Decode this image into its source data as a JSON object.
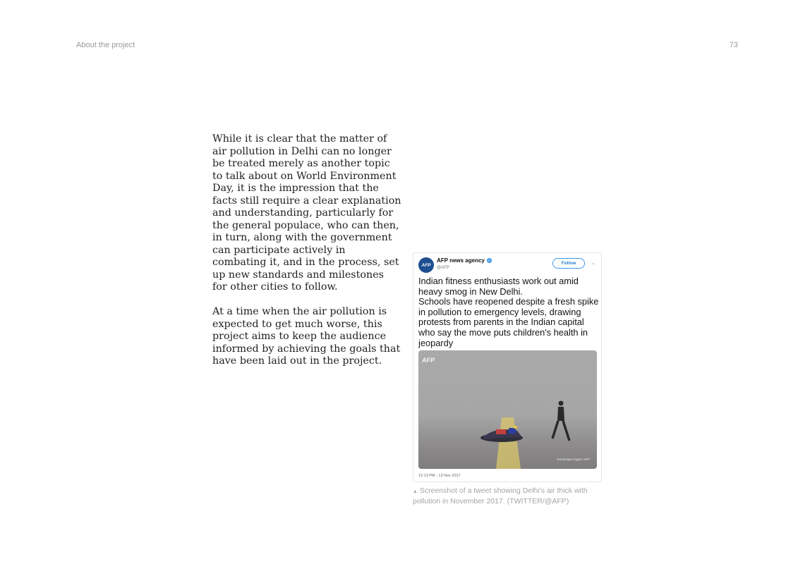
{
  "header": {
    "running_head": "About the project",
    "page_number": "73"
  },
  "body": {
    "paragraphs": [
      "While it is clear that the matter of air pollution in Delhi can no longer be treated merely as another topic to talk about on World Environment Day, it is the impression that the facts still require a clear explanation and understanding, particularly for the general populace, who can then, in turn, along with the government can participate actively in combating it, and in the process, set up new standards and milestones for other cities to follow.",
      "At a time when the air pollution is expected to get much worse, this project aims to keep the audience informed by achieving the goals that have been laid out in the project."
    ]
  },
  "figure": {
    "tweet": {
      "avatar_text": "AFP",
      "account_name": "AFP news agency",
      "verified_icon": "check-icon",
      "handle": "@AFP",
      "follow_label": "Follow",
      "chevron_icon": "chevron-down-icon",
      "text": "Indian fitness enthusiasts work out amid heavy smog in New Delhi.\nSchools have reopened despite a fresh spike in pollution to emergency levels, drawing protests from parents in the Indian capital who say the move puts children's health in jeopardy",
      "photo_logo": "AFP",
      "photo_credit": "Dominique Faget / AFP",
      "timestamp": "12:13 PM - 13 Nov 2017"
    },
    "caption_marker": "▲",
    "caption": "Screenshot of a tweet showing Delhi's air thick with pollution in November 2017. (TWITTER/@AFP)"
  },
  "colors": {
    "text": "#1f1f1f",
    "muted": "#9a9a9a",
    "twitter_blue": "#3d9ae8",
    "afp_blue": "#1d4f91"
  }
}
